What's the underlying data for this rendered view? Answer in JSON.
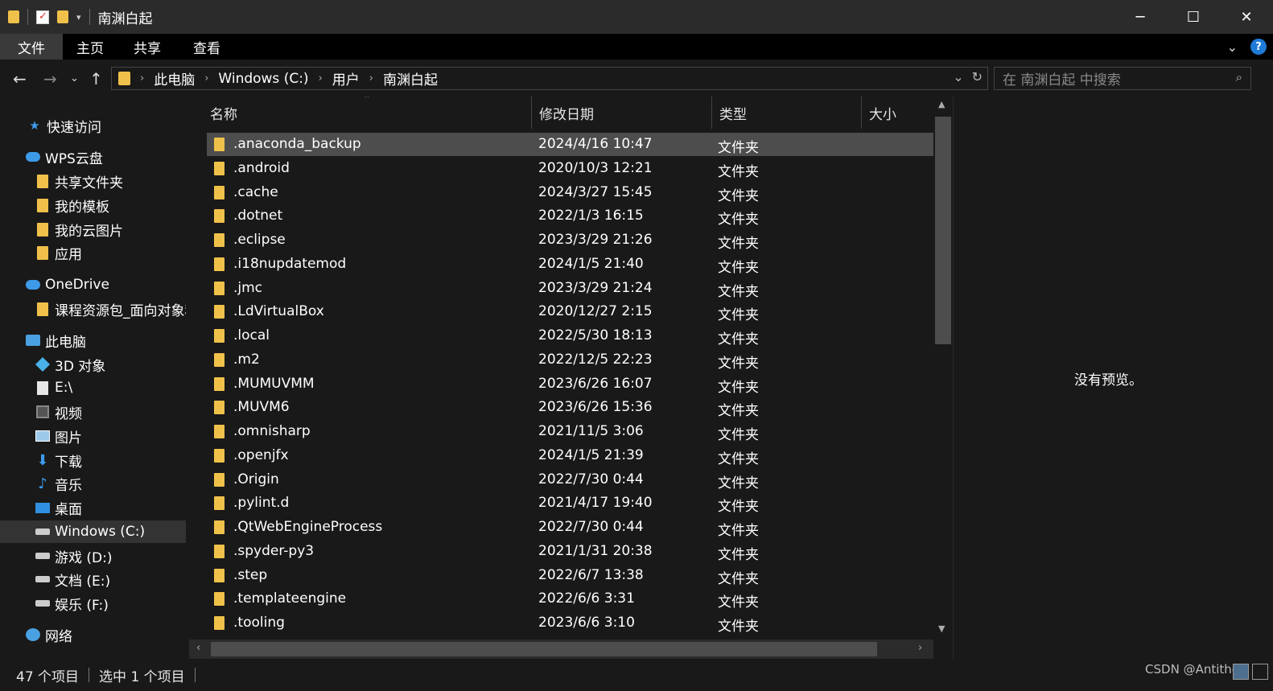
{
  "window": {
    "title": "南渊白起",
    "controls": {
      "minimize": "─",
      "maximize": "☐",
      "close": "✕"
    }
  },
  "ribbon": {
    "tabs": [
      "文件",
      "主页",
      "共享",
      "查看"
    ],
    "help": "?"
  },
  "address": {
    "crumbs": [
      "此电脑",
      "Windows (C:)",
      "用户",
      "南渊白起"
    ],
    "search_placeholder": "在 南渊白起 中搜索"
  },
  "nav": {
    "quick_access": "快速访问",
    "wps": "WPS云盘",
    "wps_items": [
      "共享文件夹",
      "我的模板",
      "我的云图片",
      "应用"
    ],
    "onedrive": "OneDrive",
    "onedrive_items": [
      "课程资源包_面向对象程"
    ],
    "this_pc": "此电脑",
    "pc_items": [
      "3D 对象",
      "E:\\",
      "视频",
      "图片",
      "下载",
      "音乐",
      "桌面",
      "Windows (C:)",
      "游戏 (D:)",
      "文档 (E:)",
      "娱乐 (F:)"
    ],
    "network": "网络"
  },
  "columns": {
    "name": "名称",
    "date": "修改日期",
    "type": "类型",
    "size": "大小"
  },
  "files": [
    {
      "name": ".anaconda_backup",
      "date": "2024/4/16 10:47",
      "type": "文件夹",
      "selected": true
    },
    {
      "name": ".android",
      "date": "2020/10/3 12:21",
      "type": "文件夹"
    },
    {
      "name": ".cache",
      "date": "2024/3/27 15:45",
      "type": "文件夹"
    },
    {
      "name": ".dotnet",
      "date": "2022/1/3 16:15",
      "type": "文件夹"
    },
    {
      "name": ".eclipse",
      "date": "2023/3/29 21:26",
      "type": "文件夹"
    },
    {
      "name": ".i18nupdatemod",
      "date": "2024/1/5 21:40",
      "type": "文件夹"
    },
    {
      "name": ".jmc",
      "date": "2023/3/29 21:24",
      "type": "文件夹"
    },
    {
      "name": ".LdVirtualBox",
      "date": "2020/12/27 2:15",
      "type": "文件夹"
    },
    {
      "name": ".local",
      "date": "2022/5/30 18:13",
      "type": "文件夹"
    },
    {
      "name": ".m2",
      "date": "2022/12/5 22:23",
      "type": "文件夹"
    },
    {
      "name": ".MUMUVMM",
      "date": "2023/6/26 16:07",
      "type": "文件夹"
    },
    {
      "name": ".MUVM6",
      "date": "2023/6/26 15:36",
      "type": "文件夹"
    },
    {
      "name": ".omnisharp",
      "date": "2021/11/5 3:06",
      "type": "文件夹"
    },
    {
      "name": ".openjfx",
      "date": "2024/1/5 21:39",
      "type": "文件夹"
    },
    {
      "name": ".Origin",
      "date": "2022/7/30 0:44",
      "type": "文件夹"
    },
    {
      "name": ".pylint.d",
      "date": "2021/4/17 19:40",
      "type": "文件夹"
    },
    {
      "name": ".QtWebEngineProcess",
      "date": "2022/7/30 0:44",
      "type": "文件夹"
    },
    {
      "name": ".spyder-py3",
      "date": "2021/1/31 20:38",
      "type": "文件夹"
    },
    {
      "name": ".step",
      "date": "2022/6/7 13:38",
      "type": "文件夹"
    },
    {
      "name": ".templateengine",
      "date": "2022/6/6 3:31",
      "type": "文件夹"
    },
    {
      "name": ".tooling",
      "date": "2023/6/6 3:10",
      "type": "文件夹"
    }
  ],
  "preview": {
    "message": "没有预览。"
  },
  "status": {
    "count": "47 个项目",
    "selected": "选中 1 个项目",
    "watermark": "CSDN @Antitheis"
  }
}
